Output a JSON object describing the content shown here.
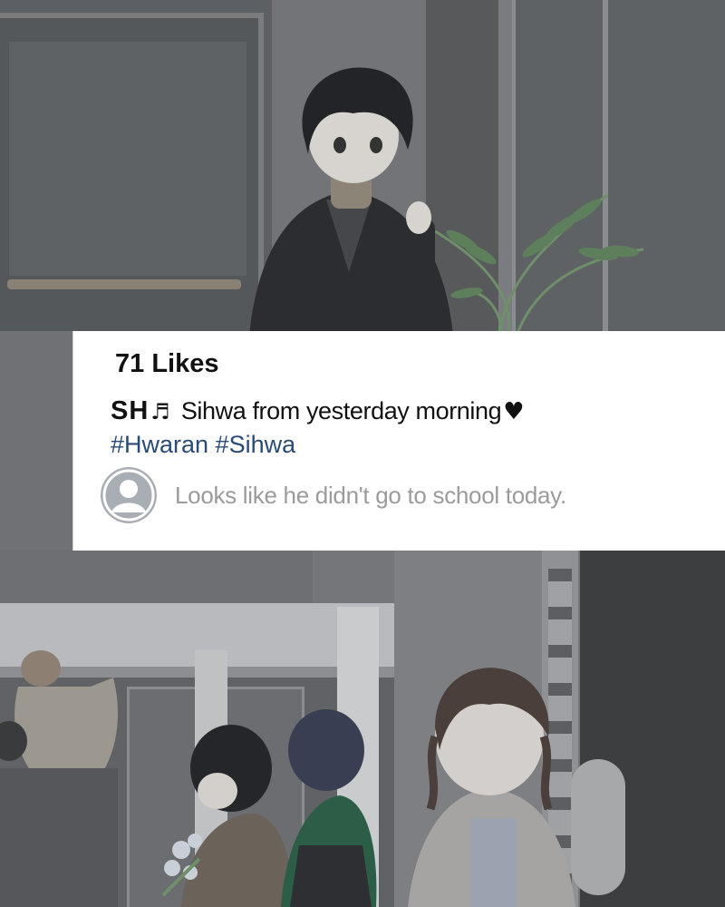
{
  "post": {
    "likes": "71 Likes",
    "username": "SH",
    "username_icon": "music-notes-icon",
    "caption": "Sihwa from yesterday morning",
    "caption_icon": "heart-icon",
    "hashtags": "#Hwaran #Sihwa",
    "comment": {
      "avatar_icon": "default-user-avatar-icon",
      "text": "Looks like he didn't go to school today."
    }
  },
  "colors": {
    "card_background": "#ffffff",
    "hashtag": "#2a4a78",
    "comment_text": "#9b9b9b",
    "avatar": "#a9adb4"
  }
}
